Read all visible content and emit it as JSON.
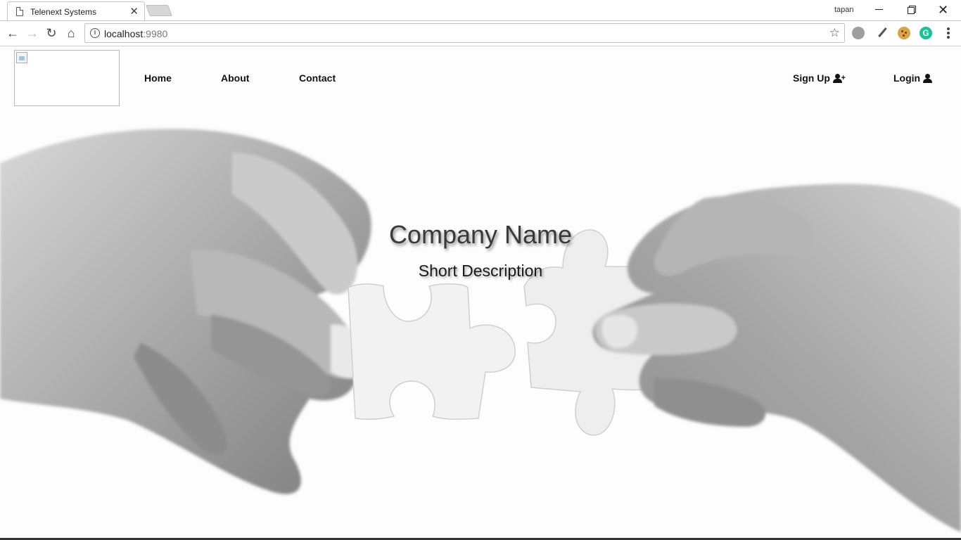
{
  "browser": {
    "tab_title": "Telenext Systems",
    "tab_close": "✕",
    "profile_name": "tapan",
    "url_host": "localhost",
    "url_port": ":9980"
  },
  "site": {
    "nav": {
      "home": "Home",
      "about": "About",
      "contact": "Contact",
      "signup": "Sign Up",
      "login": "Login"
    },
    "hero": {
      "title": "Company Name",
      "subtitle": "Short Description"
    }
  },
  "colors": {
    "nav_text": "#111111",
    "hero_title": "#3a3a3a",
    "hero_subtitle": "#1a1a1a",
    "grammarly": "#15c39a"
  }
}
